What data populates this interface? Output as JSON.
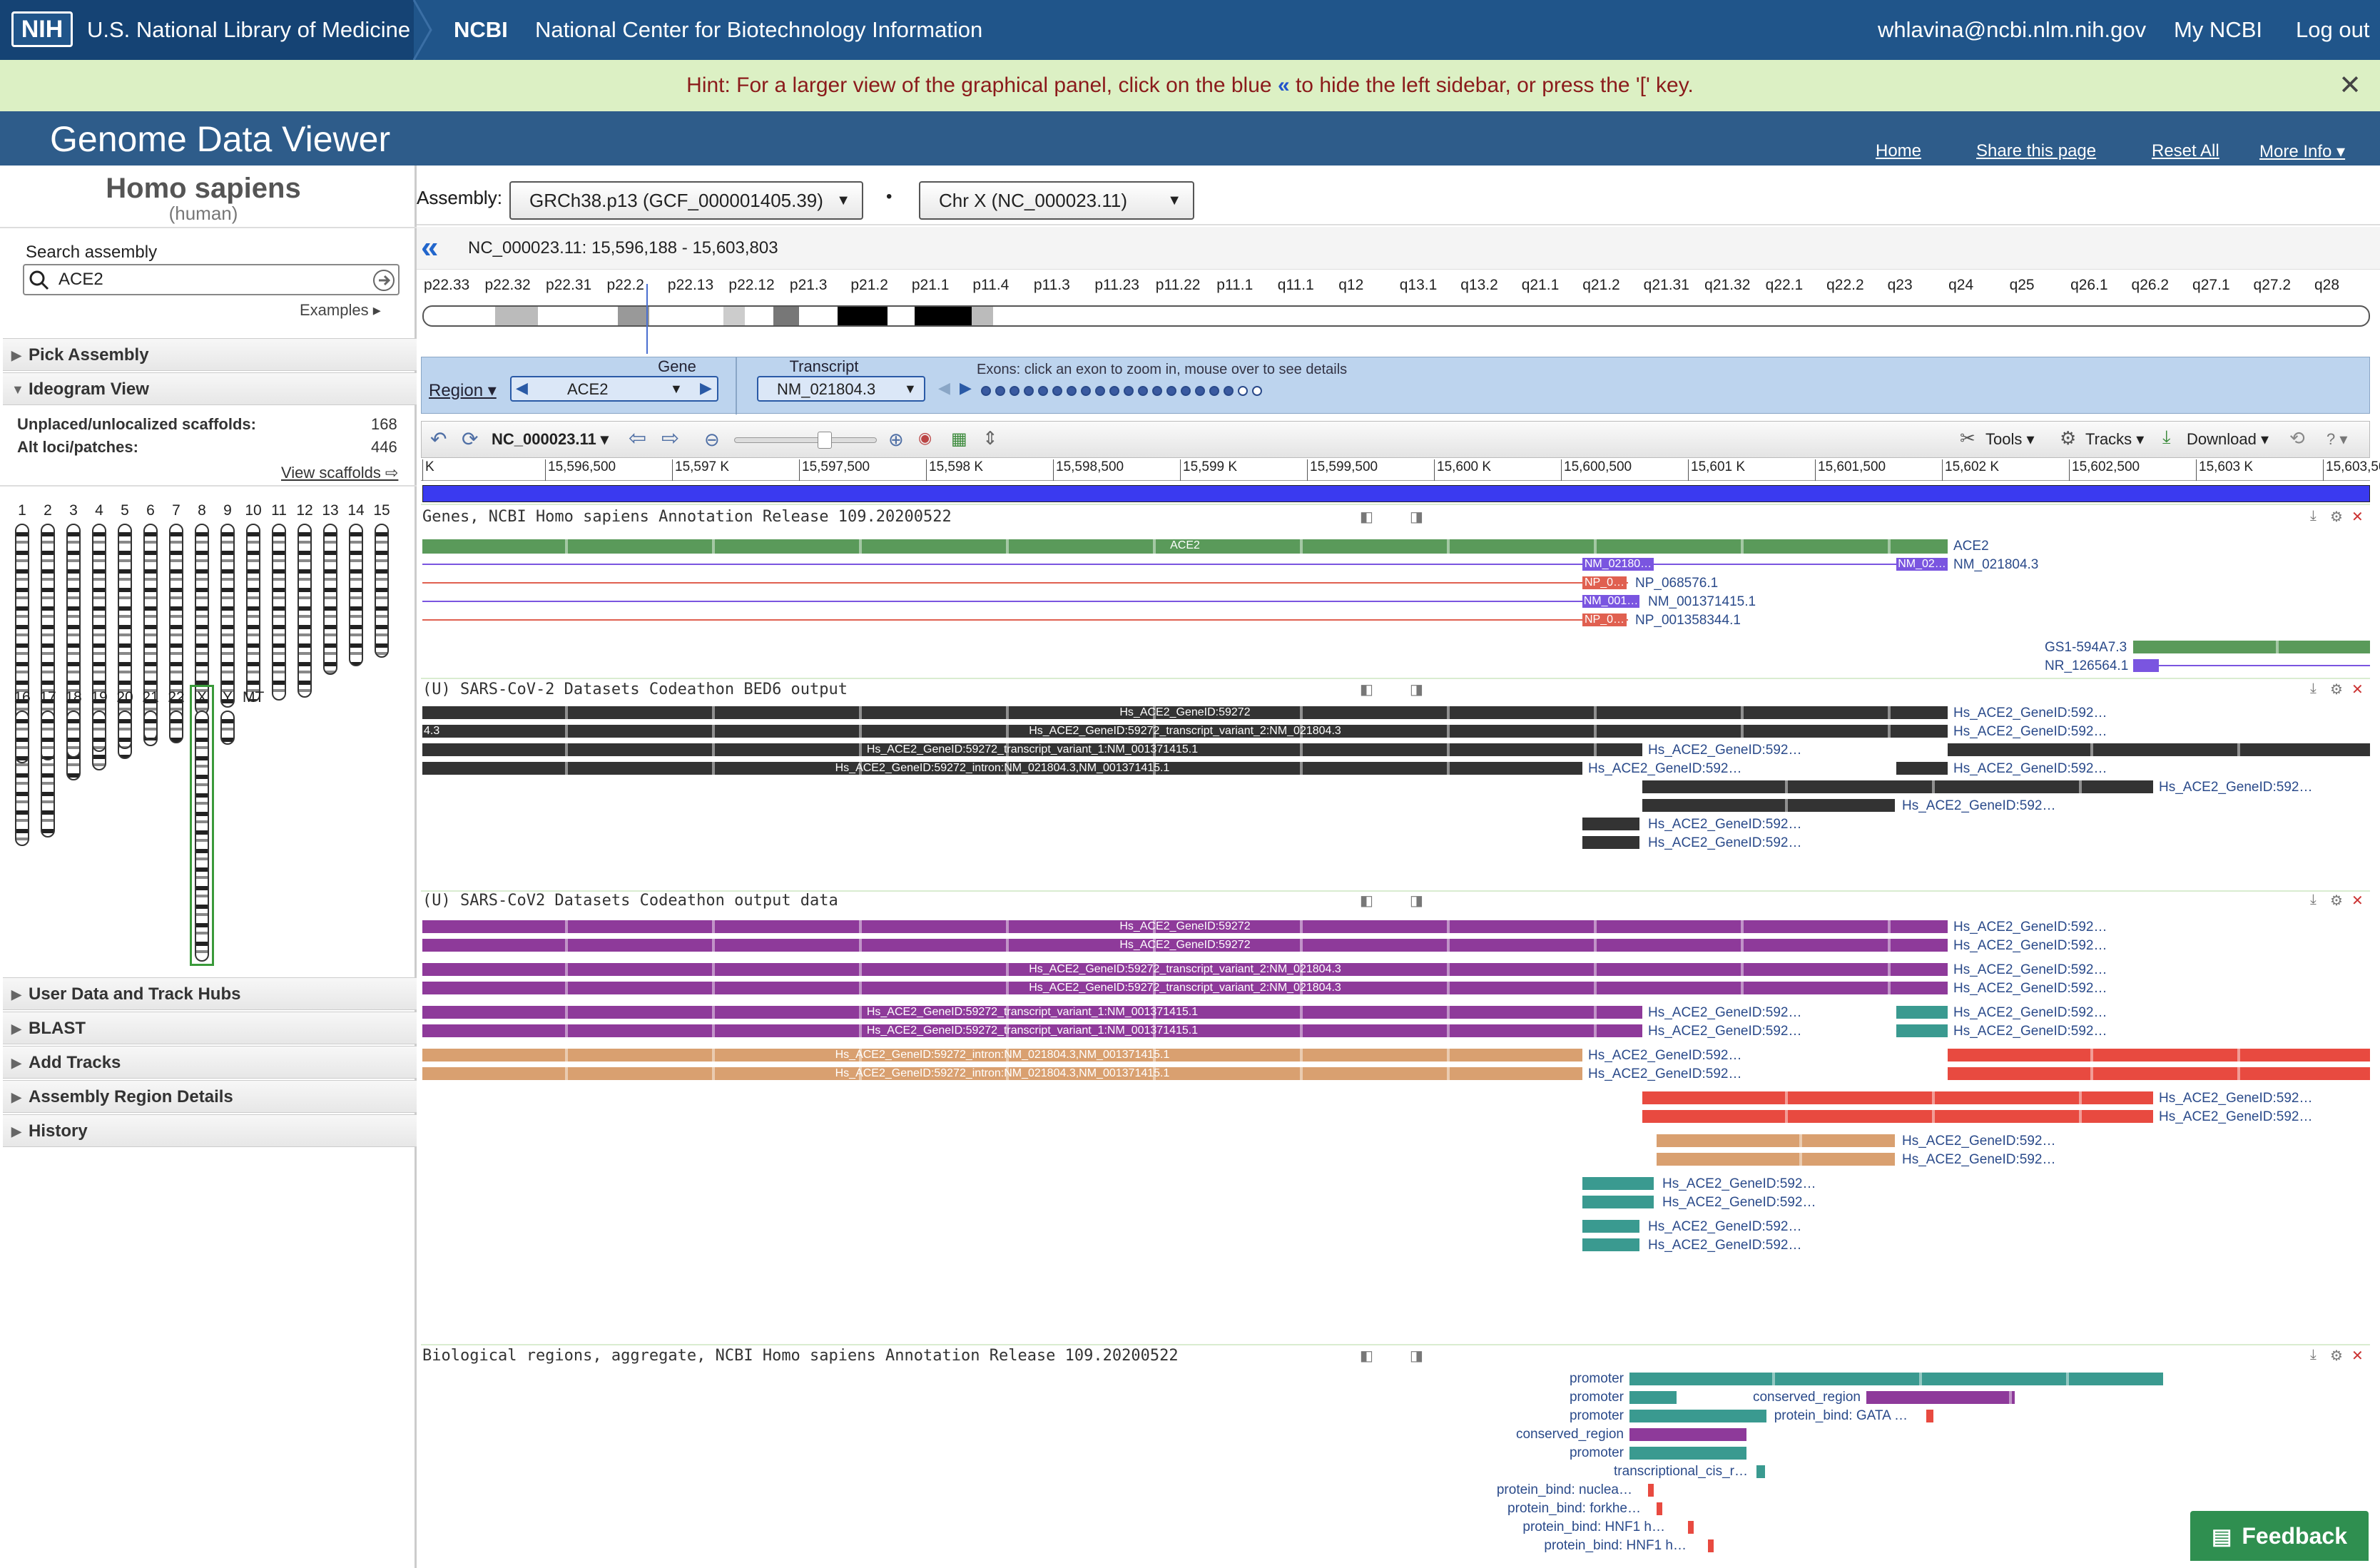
{
  "topbar": {
    "nih_logo": "NIH",
    "nlm": "U.S. National Library of Medicine",
    "ncbi": "NCBI",
    "ncbi_full": "National Center for Biotechnology Information",
    "user": "whlavina@ncbi.nlm.nih.gov",
    "my_ncbi": "My NCBI",
    "logout": "Log out"
  },
  "hint": {
    "text_before": "Hint: For a larger view of the graphical panel, click on the blue",
    "glyph": "«",
    "text_after": "to hide the left sidebar, or press the '[' key.",
    "close": "✕"
  },
  "header": {
    "title": "Genome Data Viewer",
    "links": [
      "Home",
      "Share this page",
      "Reset All",
      "More Info ▾"
    ]
  },
  "sidebar": {
    "organism": "Homo sapiens",
    "common": "(human)",
    "search_label": "Search assembly",
    "search_value": "ACE2",
    "examples": "Examples ▸",
    "pick_assembly": "Pick Assembly",
    "ideogram_view": "Ideogram View",
    "unplaced_label": "Unplaced/unlocalized scaffolds:",
    "unplaced_count": "168",
    "altloci_label": "Alt loci/patches:",
    "altloci_count": "446",
    "view_scaffolds": "View scaffolds ⇨",
    "chromosomes_row1": [
      "1",
      "2",
      "3",
      "4",
      "5",
      "6",
      "7",
      "8",
      "9",
      "10",
      "11",
      "12",
      "13",
      "14",
      "15"
    ],
    "chromosomes_row2": [
      "16",
      "17",
      "18",
      "19",
      "20",
      "21",
      "22",
      "X",
      "Y",
      "MT"
    ],
    "sections": [
      "User Data and Track Hubs",
      "BLAST",
      "Add Tracks",
      "Assembly Region Details",
      "History"
    ]
  },
  "assembly": {
    "label": "Assembly:",
    "value": "GRCh38.p13 (GCF_000001405.39)",
    "chr_value": "Chr X (NC_000023.11)",
    "sep": "•"
  },
  "location": {
    "collapse": "«",
    "text": "NC_000023.11:  15,596,188 - 15,603,803"
  },
  "ideogram_bands": [
    "p22.33",
    "p22.32",
    "p22.31",
    "p22.2",
    "p22.13",
    "p22.12",
    "p21.3",
    "p21.2",
    "p21.1",
    "p11.4",
    "p11.3",
    "p11.23",
    "p11.22",
    "p11.1",
    "q11.1",
    "q12",
    "q13.1",
    "q13.2",
    "q21.1",
    "q21.2",
    "q21.31",
    "q21.32",
    "q22.1",
    "q22.2",
    "q23",
    "q24",
    "q25",
    "q26.1",
    "q26.2",
    "q27.1",
    "q27.2",
    "q28"
  ],
  "navigator": {
    "region": "Region ▾",
    "gene_label": "Gene",
    "gene_value": "ACE2",
    "transcript_label": "Transcript",
    "transcript_value": "NM_021804.3",
    "exons_hint": "Exons: click an exon to zoom in, mouse over to see details"
  },
  "toolbar": {
    "seqid": "NC_000023.11 ▾",
    "tools": "Tools ▾",
    "tracks": "Tracks ▾",
    "download": "Download ▾",
    "help": "? ▾"
  },
  "ruler": [
    "K",
    "15,596,500",
    "15,597 K",
    "15,597,500",
    "15,598 K",
    "15,598,500",
    "15,599 K",
    "15,599,500",
    "15,600 K",
    "15,600,500",
    "15,601 K",
    "15,601,500",
    "15,602 K",
    "15,602,500",
    "15,603 K",
    "15,603,500"
  ],
  "tracks": {
    "genes_title": "Genes, NCBI Homo sapiens Annotation Release 109.20200522",
    "genes_labels": [
      "ACE2",
      "ACE2",
      "NM_021804.3",
      "NP_068576.1",
      "NM_001371415.1",
      "NP_001358344.1",
      "GS1-594A7.3",
      "NR_126564.1",
      "NM_02180…",
      "NM_02…",
      "NP_0…",
      "NM_001…",
      "NP_0…"
    ],
    "bed6_title": "(U) SARS-CoV-2 Datasets Codeathon BED6 output",
    "bed6_inner": [
      "Hs_ACE2_GeneID:59272",
      "Hs_ACE2_GeneID:59272_transcript_variant_2:NM_021804.3",
      "Hs_ACE2_GeneID:59272_transcript_variant_1:NM_001371415.1",
      "Hs_ACE2_GeneID:59272_intron:NM_021804.3,NM_001371415.1",
      "4.3"
    ],
    "short_label": "Hs_ACE2_GeneID:592…",
    "output_title": "(U) SARS-CoV2 Datasets Codeathon output data",
    "bio_title": "Biological regions, aggregate, NCBI Homo sapiens Annotation Release 109.20200522",
    "bio_labels": [
      "promoter",
      "promoter",
      "conserved_region",
      "promoter",
      "protein_bind: GATA …",
      "conserved_region",
      "promoter",
      "transcriptional_cis_r…",
      "protein_bind: nuclea…",
      "protein_bind: forkhe…",
      "protein_bind: HNF1 h…",
      "protein_bind: HNF1 h…"
    ]
  },
  "feedback": "Feedback"
}
